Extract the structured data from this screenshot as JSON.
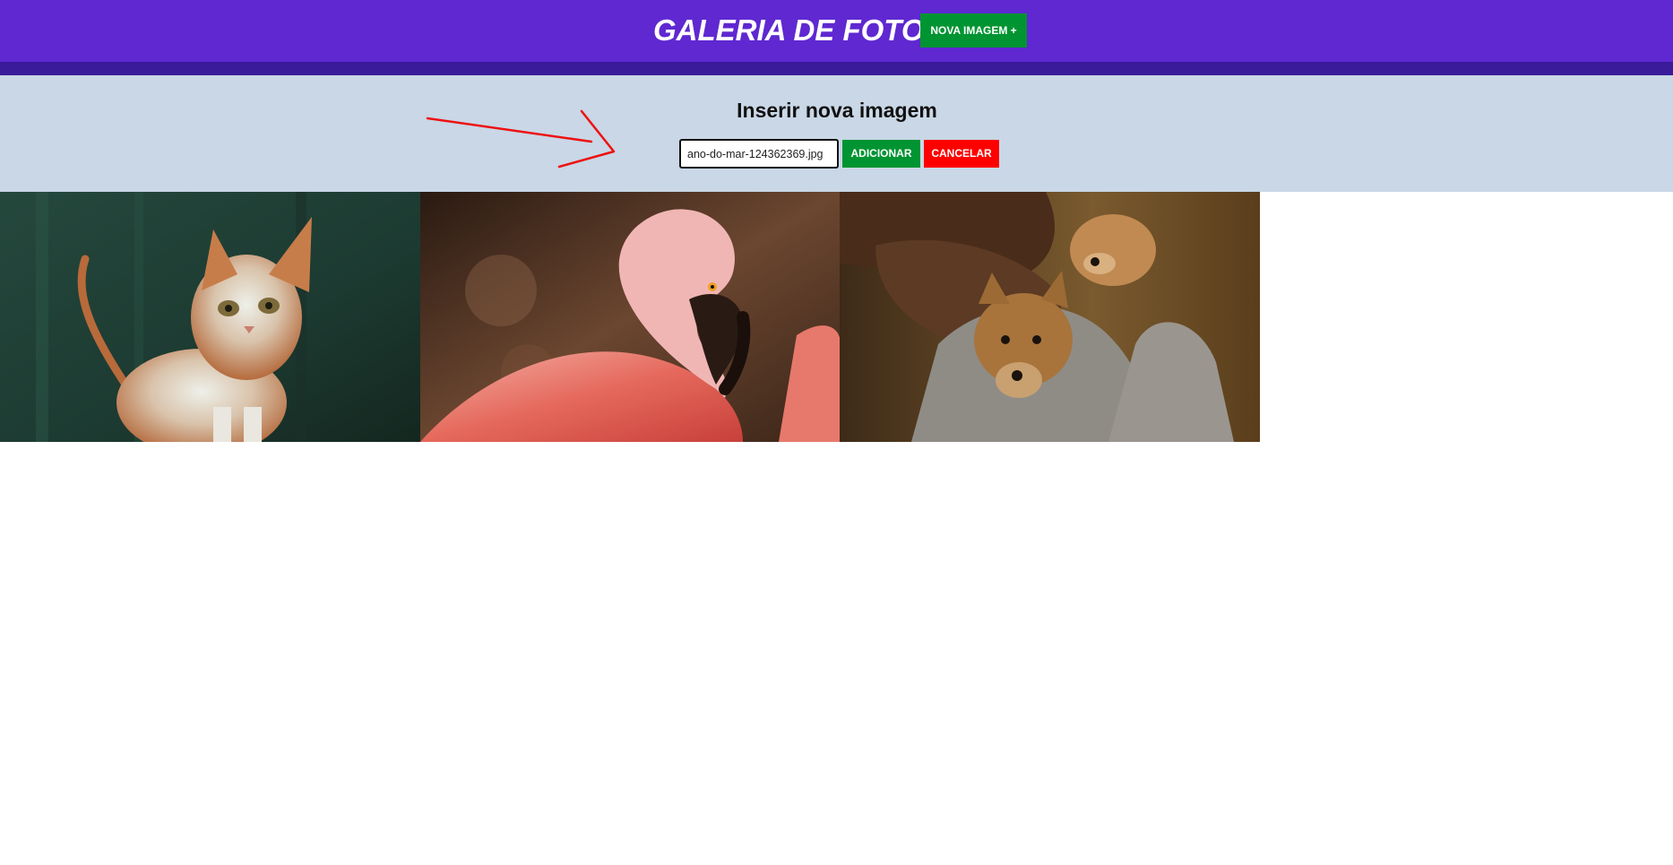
{
  "header": {
    "title": "GALERIA DE FOTOS",
    "new_image_button": "NOVA IMAGEM +"
  },
  "form": {
    "title": "Inserir nova imagem",
    "url_value": "ano-do-mar-124362369.jpg",
    "add_button": "ADICIONAR",
    "cancel_button": "CANCELAR"
  },
  "gallery": {
    "photos": [
      {
        "subject": "kitten"
      },
      {
        "subject": "flamingo"
      },
      {
        "subject": "puppies"
      }
    ]
  },
  "colors": {
    "header": "#5f28d1",
    "header_strip": "#3a1b9a",
    "panel": "#c9d7e6",
    "green": "#009432",
    "red": "#ff0000",
    "annotation_arrow": "#ee1111"
  },
  "icons": {
    "annotation": "arrow-icon"
  }
}
